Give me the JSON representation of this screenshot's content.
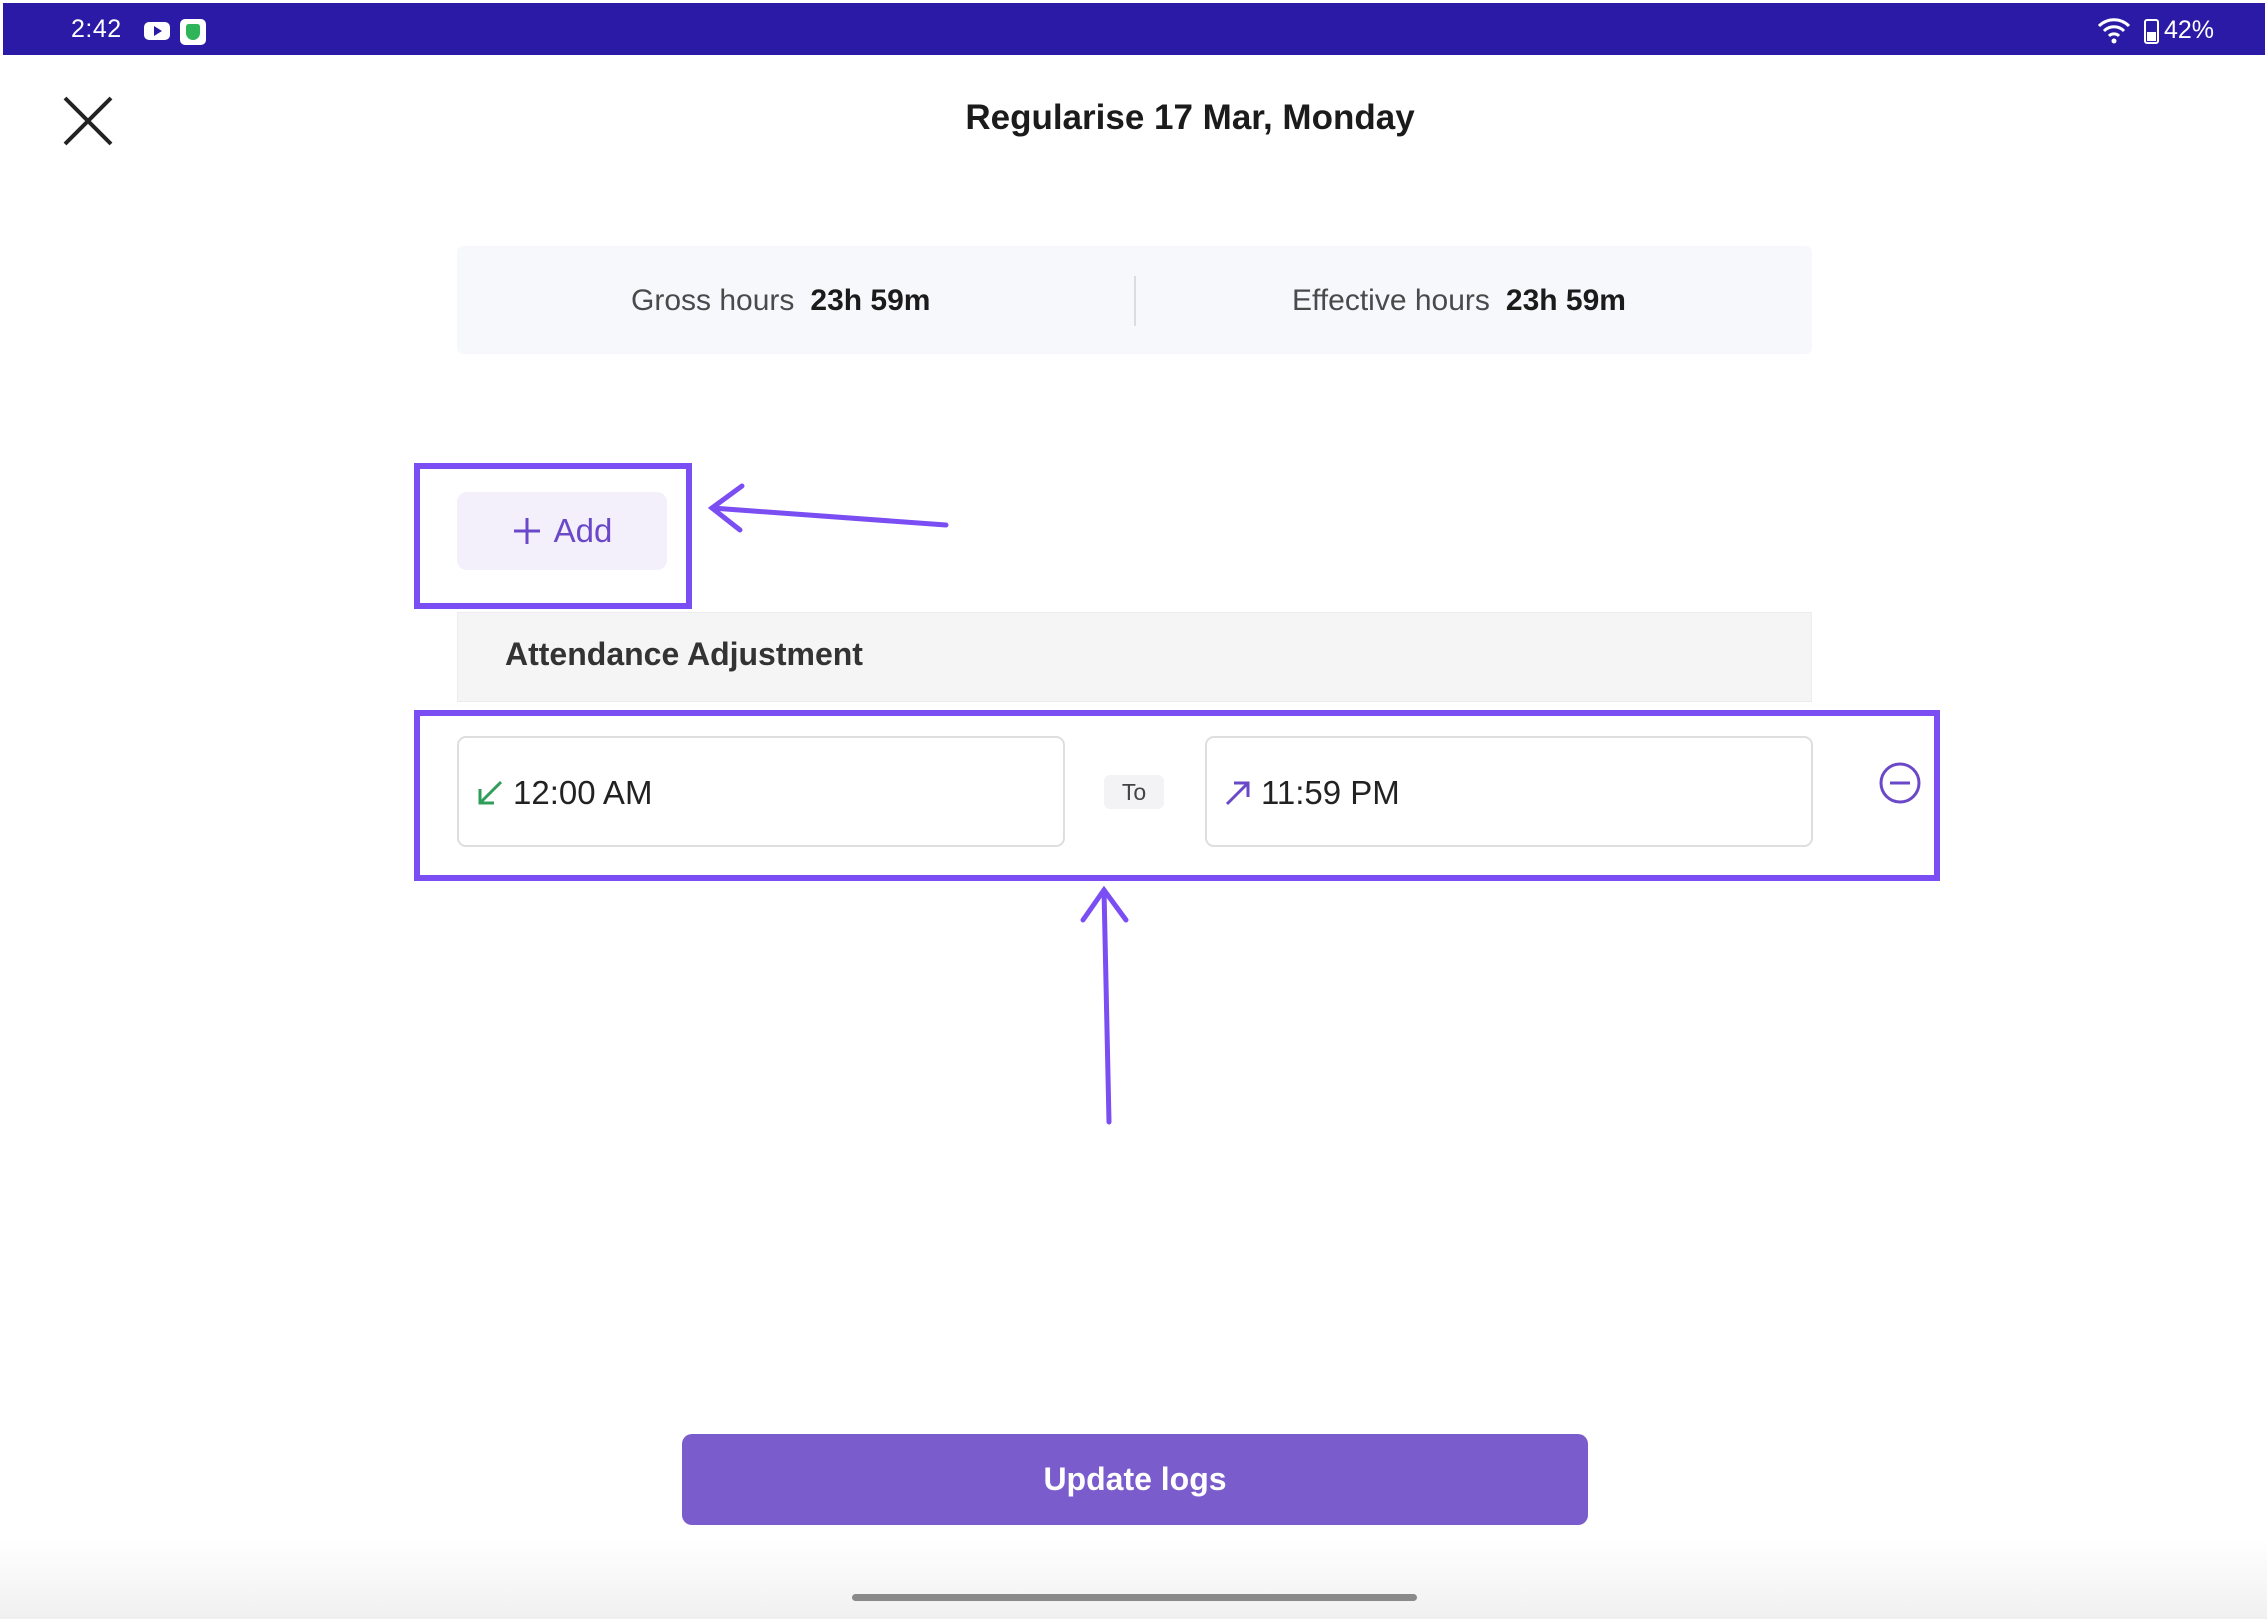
{
  "status_bar": {
    "time": "2:42",
    "battery": "42%",
    "background": "#2a1aa6"
  },
  "header": {
    "title": "Regularise 17 Mar, Monday",
    "close_icon": "close-icon"
  },
  "hours": {
    "gross_label": "Gross hours",
    "gross_value": "23h 59m",
    "effective_label": "Effective hours",
    "effective_value": "23h 59m"
  },
  "add_button": {
    "label": "Add",
    "icon": "plus-icon"
  },
  "section": {
    "title": "Attendance Adjustment"
  },
  "log_entry": {
    "in_time": "12:00 AM",
    "separator": "To",
    "out_time": "11:59 PM",
    "in_icon_color": "#2f9e5a",
    "out_icon_color": "#6b48c8"
  },
  "footer": {
    "update_label": "Update logs",
    "accent": "#7a5ccc"
  },
  "annotation": {
    "highlight_color": "#7a4ef2"
  }
}
